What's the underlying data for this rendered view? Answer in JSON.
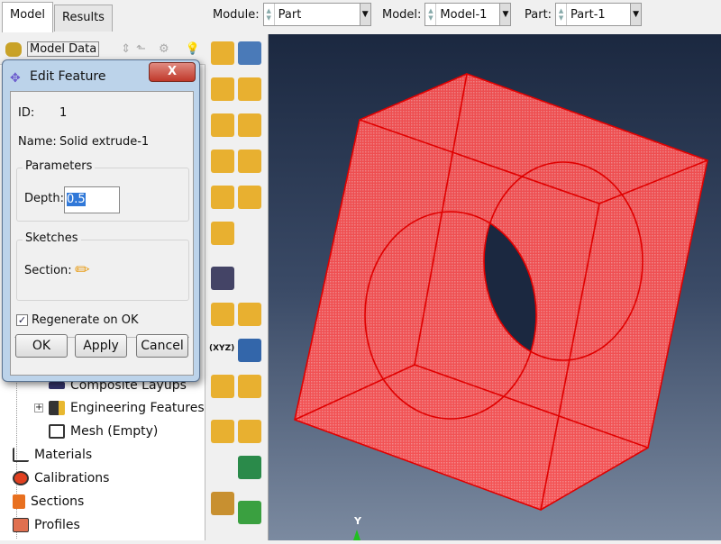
{
  "tabs": [
    {
      "label": "Model",
      "active": true
    },
    {
      "label": "Results",
      "active": false
    }
  ],
  "context": {
    "module_label": "Module:",
    "module_value": "Part",
    "model_label": "Model:",
    "model_value": "Model-1",
    "part_label": "Part:",
    "part_value": "Part-1"
  },
  "model_tree": {
    "dropdown": "Model Data",
    "items": [
      "Composite Layups",
      "Engineering Features",
      "Mesh (Empty)",
      "Materials",
      "Calibrations",
      "Sections",
      "Profiles"
    ]
  },
  "dialog": {
    "title": "Edit Feature",
    "close": "X",
    "id_label": "ID:",
    "id_value": "1",
    "name_label": "Name:",
    "name_value": "Solid extrude-1",
    "parameters_group": "Parameters",
    "depth_label": "Depth:",
    "depth_value": "0.5",
    "sketches_group": "Sketches",
    "section_label": "Section:",
    "regenerate_label": "Regenerate on OK",
    "regenerate_checked": true,
    "ok": "OK",
    "apply": "Apply",
    "cancel": "Cancel"
  },
  "viewport": {
    "axis_label": "Y",
    "part_color": "#ff3b3b",
    "edge_color": "#e00000"
  },
  "toolbox_label": "(XYZ)"
}
